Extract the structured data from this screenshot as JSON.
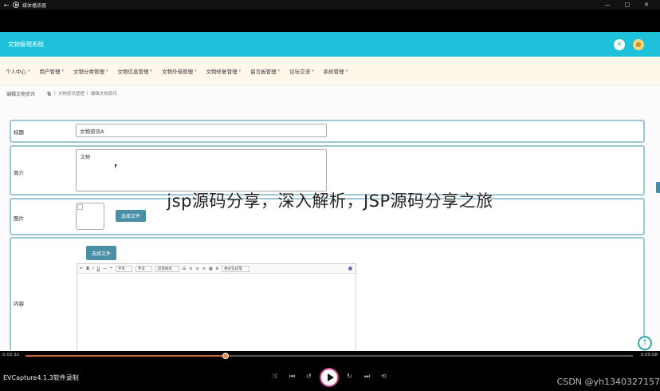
{
  "player": {
    "window_title": "媒体播放器",
    "back_icon": "back-arrow-icon",
    "window_buttons": [
      "—",
      "□",
      "✕"
    ],
    "current_time": "0:02:32",
    "duration": "0:05:08",
    "progress": 0.33,
    "recorder_label": "EVCapture4.1.3软件录制"
  },
  "app": {
    "title": "文物管理系统",
    "colors": {
      "header": "#1ec0da",
      "nav_bg": "#fff7ea",
      "row_border": "#9cc7d6",
      "button": "#4b8fa6"
    },
    "nav_items": [
      "个人中心",
      "用户管理",
      "文物分类管理",
      "文物信息管理",
      "文物外借管理",
      "文物修复管理",
      "留言板管理",
      "论坛交流",
      "系统管理"
    ],
    "page_title": "编辑文物资讯",
    "breadcrumbs": [
      "文物资讯管理",
      "编辑文物资讯"
    ]
  },
  "form": {
    "title_label": "标题",
    "title_value": "文物资讯A",
    "intro_label": "简介",
    "intro_value": "文物",
    "image_label": "图片",
    "image_button": "选择文件",
    "content_label": "内容",
    "content_button": "选择文件",
    "editor_toolbar": {
      "font_family": "字体",
      "font_size": "字号",
      "format": "段落格式",
      "tail": "格式化段落"
    }
  },
  "overlay": {
    "headline": "jsp源码分享，深入解析，JSP源码分享之旅"
  },
  "watermark": "CSDN @yh1340327157"
}
